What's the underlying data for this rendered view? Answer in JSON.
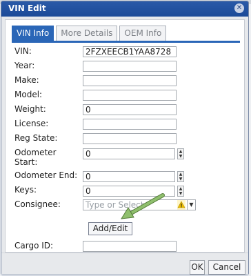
{
  "window": {
    "title": "VIN Edit"
  },
  "tabs": [
    "VIN Info",
    "More Details",
    "OEM Info"
  ],
  "fields": {
    "vin": {
      "label": "VIN:",
      "value": "2FZXEECB1YAA8728"
    },
    "year": {
      "label": "Year:",
      "value": ""
    },
    "make": {
      "label": "Make:",
      "value": ""
    },
    "model": {
      "label": "Model:",
      "value": ""
    },
    "weight": {
      "label": "Weight:",
      "value": "0"
    },
    "license": {
      "label": "License:",
      "value": ""
    },
    "reg_state": {
      "label": "Reg State:",
      "value": ""
    },
    "odometer_start": {
      "label_line1": "Odometer",
      "label_line2": "Start:",
      "value": "0"
    },
    "odometer_end": {
      "label": "Odometer End:",
      "value": "0"
    },
    "keys": {
      "label": "Keys:",
      "value": "0"
    },
    "consignee": {
      "label": "Consignee:",
      "placeholder": "Type or Select"
    },
    "cargo_id": {
      "label": "Cargo ID:",
      "value": ""
    }
  },
  "buttons": {
    "add_edit": "Add/Edit",
    "ok": "OK",
    "cancel": "Cancel"
  },
  "colors": {
    "title_bar": "#1b4a98",
    "active_tab": "#2a66b7",
    "annotation_arrow": "#8fbf6d"
  },
  "icons": {
    "close": "close-icon",
    "warning": "warning-icon",
    "dropdown": "chevron-down-icon",
    "spinner": "spinner-icon"
  }
}
